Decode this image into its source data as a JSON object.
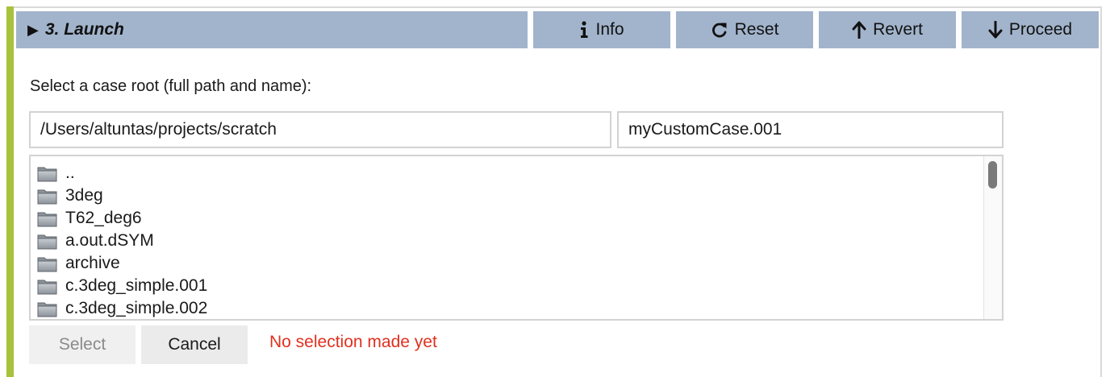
{
  "header": {
    "title": "3. Launch",
    "collapse_icon": "triangle-right-icon",
    "buttons": [
      {
        "label": "Info",
        "icon": "info-icon"
      },
      {
        "label": "Reset",
        "icon": "redo-icon"
      },
      {
        "label": "Revert",
        "icon": "arrow-up-icon"
      },
      {
        "label": "Proceed",
        "icon": "arrow-down-icon"
      }
    ]
  },
  "colors": {
    "header_bg": "#a2b4cc",
    "accent": "#a8c23b",
    "error_text": "#e0301e"
  },
  "case_root": {
    "prompt": "Select a case root (full path and name):",
    "path_value": "/Users/altuntas/projects/scratch",
    "name_value": "myCustomCase.001"
  },
  "file_list": {
    "items": [
      {
        "name": "..",
        "icon": "folder-icon"
      },
      {
        "name": "3deg",
        "icon": "folder-icon"
      },
      {
        "name": "T62_deg6",
        "icon": "folder-icon"
      },
      {
        "name": "a.out.dSYM",
        "icon": "folder-icon"
      },
      {
        "name": "archive",
        "icon": "folder-icon"
      },
      {
        "name": "c.3deg_simple.001",
        "icon": "folder-icon"
      },
      {
        "name": "c.3deg_simple.002",
        "icon": "folder-icon"
      }
    ]
  },
  "actions": {
    "select_label": "Select",
    "cancel_label": "Cancel",
    "status_text": "No selection made yet"
  }
}
